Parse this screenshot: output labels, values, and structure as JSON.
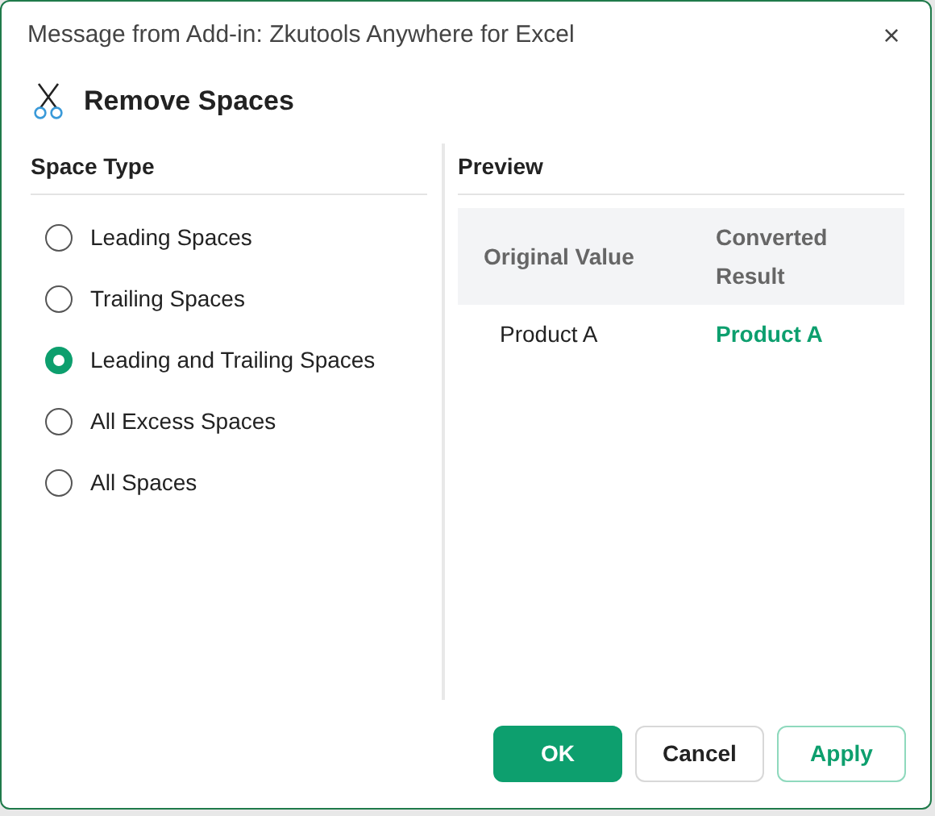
{
  "window": {
    "title": "Message from Add-in: Zkutools Anywhere for Excel",
    "close": "×"
  },
  "heading": "Remove Spaces",
  "space_type": {
    "title": "Space Type",
    "options": [
      {
        "label": "Leading Spaces",
        "selected": false
      },
      {
        "label": "Trailing Spaces",
        "selected": false
      },
      {
        "label": "Leading and Trailing Spaces",
        "selected": true
      },
      {
        "label": "All Excess Spaces",
        "selected": false
      },
      {
        "label": "All Spaces",
        "selected": false
      }
    ]
  },
  "preview": {
    "title": "Preview",
    "columns": [
      "Original Value",
      "Converted Result"
    ],
    "rows": [
      [
        "Product A",
        "Product A"
      ]
    ]
  },
  "buttons": [
    {
      "label": "OK",
      "kind": "primary"
    },
    {
      "label": "Cancel",
      "kind": "secondary"
    },
    {
      "label": "Apply",
      "kind": "outline"
    }
  ]
}
